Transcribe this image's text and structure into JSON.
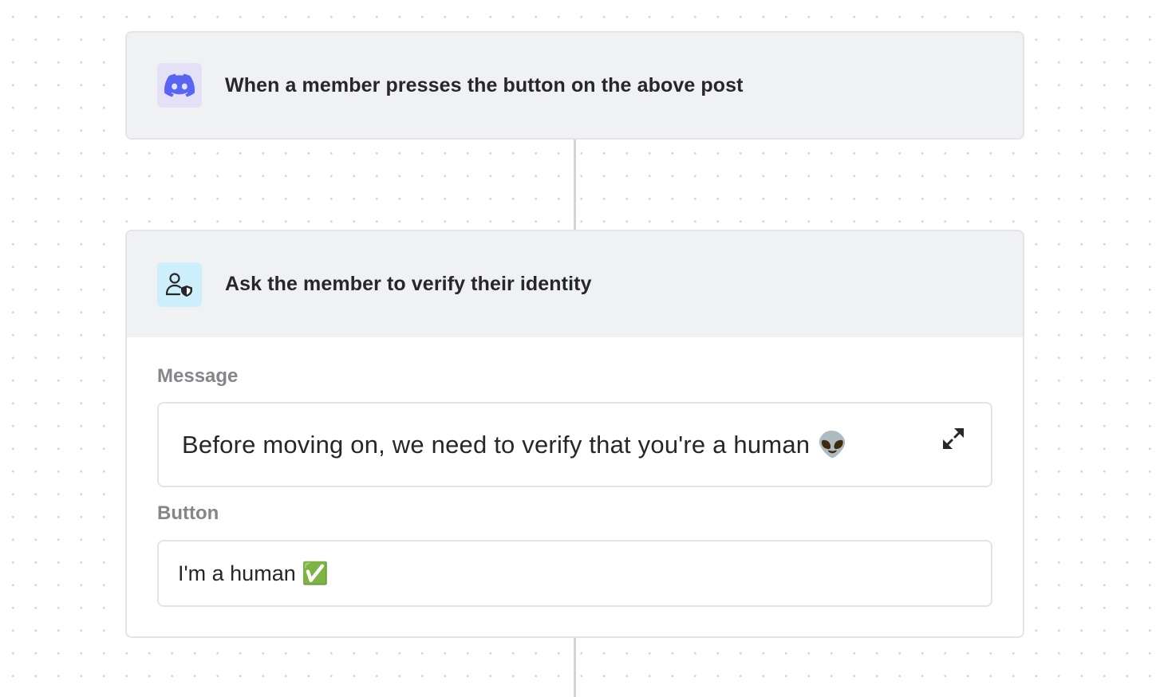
{
  "trigger": {
    "icon": "discord-icon",
    "icon_color": "#5865f2",
    "title": "When a member presses the button on the above post"
  },
  "action": {
    "icon": "user-shield-icon",
    "title": "Ask the member to verify their identity",
    "message": {
      "label": "Message",
      "value": "Before moving on, we need to verify that you're a human 👽"
    },
    "button": {
      "label": "Button",
      "value": "I'm a human ✅"
    }
  }
}
